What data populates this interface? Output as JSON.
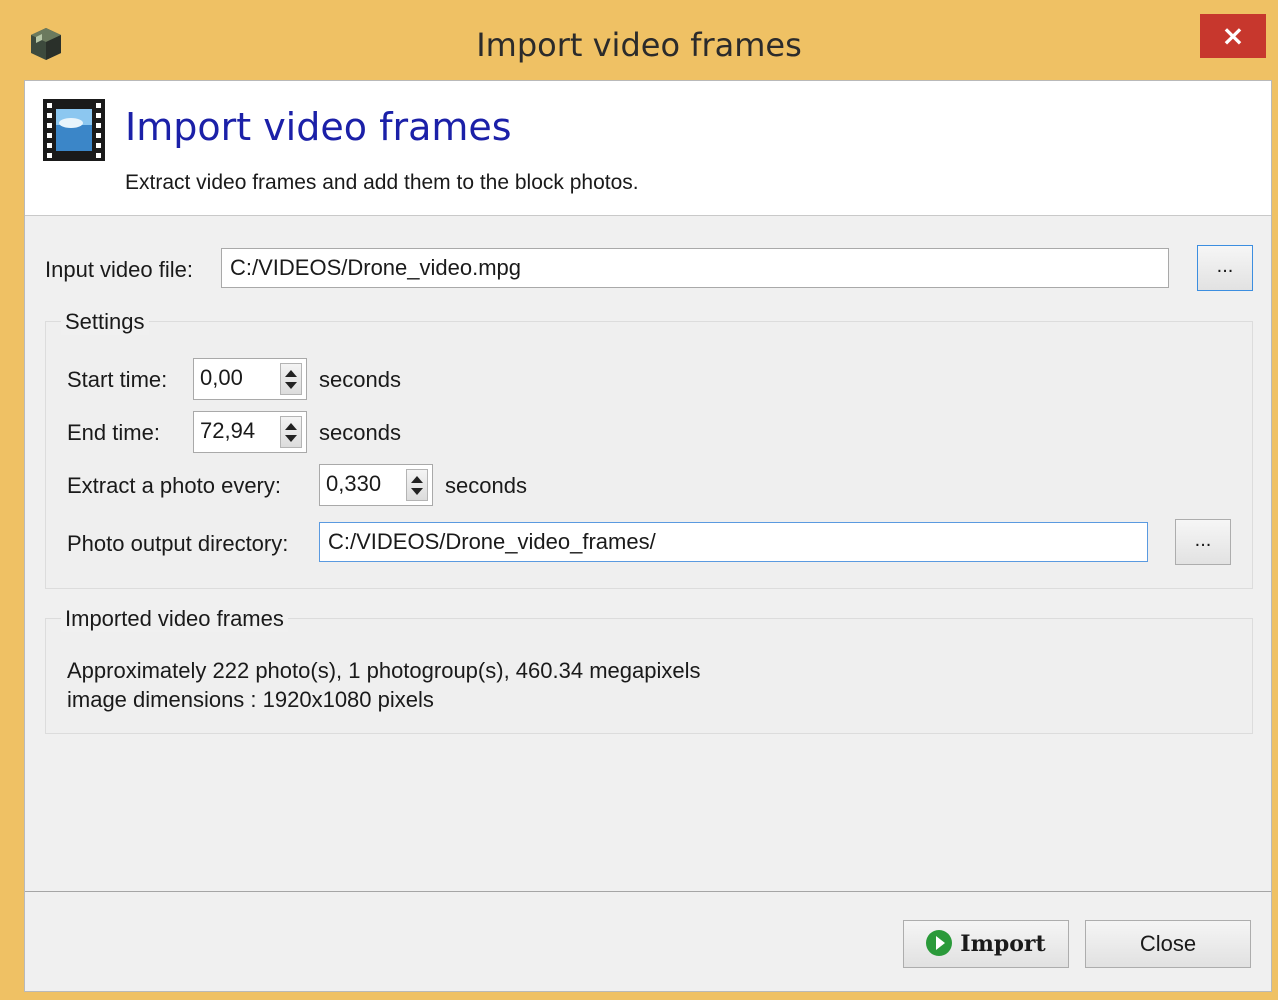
{
  "window": {
    "title": "Import video frames",
    "close_label": "×"
  },
  "header": {
    "title": "Import video frames",
    "subtitle": "Extract video frames and add them to the block photos."
  },
  "input": {
    "label": "Input video file:",
    "value": "C:/VIDEOS/Drone_video.mpg",
    "browse_label": "..."
  },
  "settings": {
    "group_title": "Settings",
    "start": {
      "label": "Start time:",
      "value": "0,00",
      "unit": "seconds"
    },
    "end": {
      "label": "End time:",
      "value": "72,94",
      "unit": "seconds"
    },
    "every": {
      "label": "Extract a photo every:",
      "value": "0,330",
      "unit": "seconds"
    },
    "output": {
      "label": "Photo output directory:",
      "value": "C:/VIDEOS/Drone_video_frames/",
      "browse_label": "..."
    }
  },
  "imported": {
    "group_title": "Imported video frames",
    "line1": "Approximately 222 photo(s), 1 photogroup(s), 460.34 megapixels",
    "line2": "image dimensions : 1920x1080 pixels"
  },
  "footer": {
    "import_label": "Import",
    "close_label": "Close"
  },
  "colors": {
    "title_accent": "#1b20a8",
    "close_red": "#c7372d",
    "frame": "#efc164",
    "import_icon": "#2a9a3a"
  }
}
